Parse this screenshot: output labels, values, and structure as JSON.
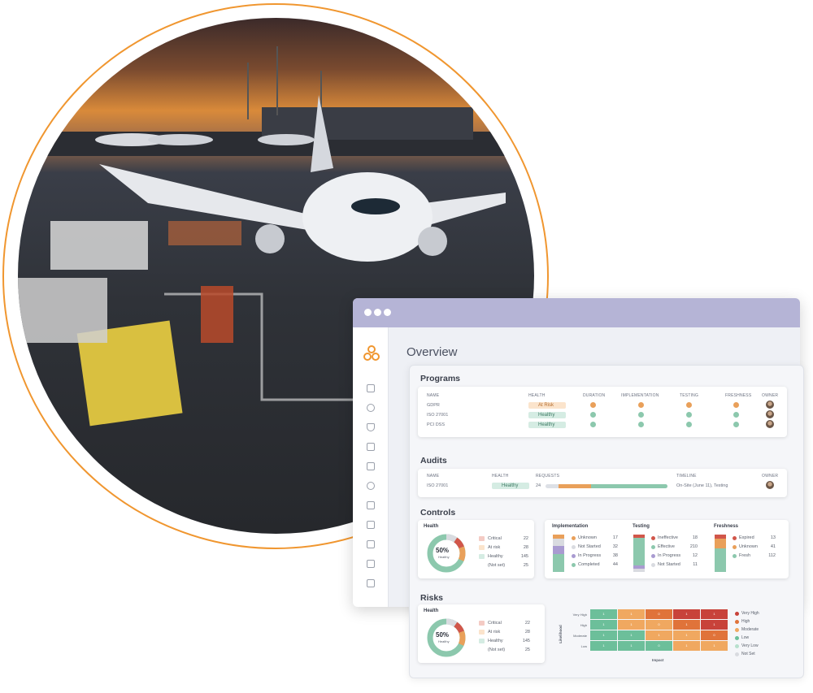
{
  "window": {
    "title": "Overview"
  },
  "sidebar_icons": [
    "dashboard-icon",
    "box-icon",
    "shield-icon",
    "branch-icon",
    "document-edit-icon",
    "cloud-icon",
    "report-icon",
    "clipboard-icon",
    "checklist-icon",
    "flag-icon",
    "truck-icon"
  ],
  "programs": {
    "title": "Programs",
    "headers": {
      "name": "NAME",
      "health": "HEALTH",
      "duration": "DURATION",
      "implementation": "IMPLEMENTATION",
      "testing": "TESTING",
      "freshness": "FRESHNESS",
      "owner": "OWNER"
    },
    "rows": [
      {
        "name": "GDPR",
        "health": "At Risk",
        "status": "risk"
      },
      {
        "name": "ISO 27001",
        "health": "Healthy",
        "status": "healthy"
      },
      {
        "name": "PCI DSS",
        "health": "Healthy",
        "status": "healthy"
      }
    ]
  },
  "audits": {
    "title": "Audits",
    "headers": {
      "name": "NAME",
      "health": "HEALTH",
      "requests": "REQUESTS",
      "timeline": "TIMELINE",
      "owner": "OWNER"
    },
    "row": {
      "name": "ISO 27001",
      "health": "Healthy",
      "requests": "24",
      "timeline": "On-Site (June 11), Testing"
    }
  },
  "controls": {
    "title": "Controls",
    "health": {
      "title": "Health",
      "percent": "50%",
      "label": "Healthy",
      "legend": [
        {
          "label": "Critical",
          "value": "22"
        },
        {
          "label": "At risk",
          "value": "28"
        },
        {
          "label": "Healthy",
          "value": "145"
        },
        {
          "label": "(Not set)",
          "value": "25"
        }
      ]
    },
    "implementation": {
      "title": "Implementation",
      "items": [
        {
          "label": "Unknown",
          "value": "17"
        },
        {
          "label": "Not Started",
          "value": "32"
        },
        {
          "label": "In Progress",
          "value": "38"
        },
        {
          "label": "Completed",
          "value": "44"
        }
      ]
    },
    "testing": {
      "title": "Testing",
      "items": [
        {
          "label": "Ineffective",
          "value": "18"
        },
        {
          "label": "Effective",
          "value": "210"
        },
        {
          "label": "In Progress",
          "value": "12"
        },
        {
          "label": "Not Started",
          "value": "11"
        }
      ]
    },
    "freshness": {
      "title": "Freshness",
      "items": [
        {
          "label": "Expired",
          "value": "13"
        },
        {
          "label": "Unknown",
          "value": "41"
        },
        {
          "label": "Fresh",
          "value": "112"
        }
      ]
    }
  },
  "risks": {
    "title": "Risks",
    "health": {
      "title": "Health",
      "percent": "50%",
      "label": "Healthy",
      "legend": [
        {
          "label": "Critical",
          "value": "22"
        },
        {
          "label": "At risk",
          "value": "28"
        },
        {
          "label": "Healthy",
          "value": "145"
        },
        {
          "label": "(Not set)",
          "value": "25"
        }
      ]
    },
    "heatmap": {
      "ylabel": "Likelihood",
      "xlabel": "Impact",
      "rows": [
        "Very High",
        "High",
        "Moderate",
        "Low"
      ],
      "cells": [
        [
          "1",
          "1",
          "0",
          "1",
          "1"
        ],
        [
          "1",
          "1",
          "0",
          "1",
          "1"
        ],
        [
          "1",
          "1",
          "1",
          "1",
          "0"
        ],
        [
          "1",
          "1",
          "0",
          "1",
          "1"
        ]
      ],
      "legend": [
        "Very High",
        "High",
        "Moderate",
        "Low",
        "Very Low",
        "Not Set"
      ]
    }
  },
  "colors": {
    "accent": "#f0962f",
    "healthy": "#8cc8ad",
    "risk": "#e9a05a",
    "critical": "#d1564a",
    "purple": "#b5b4d6"
  }
}
